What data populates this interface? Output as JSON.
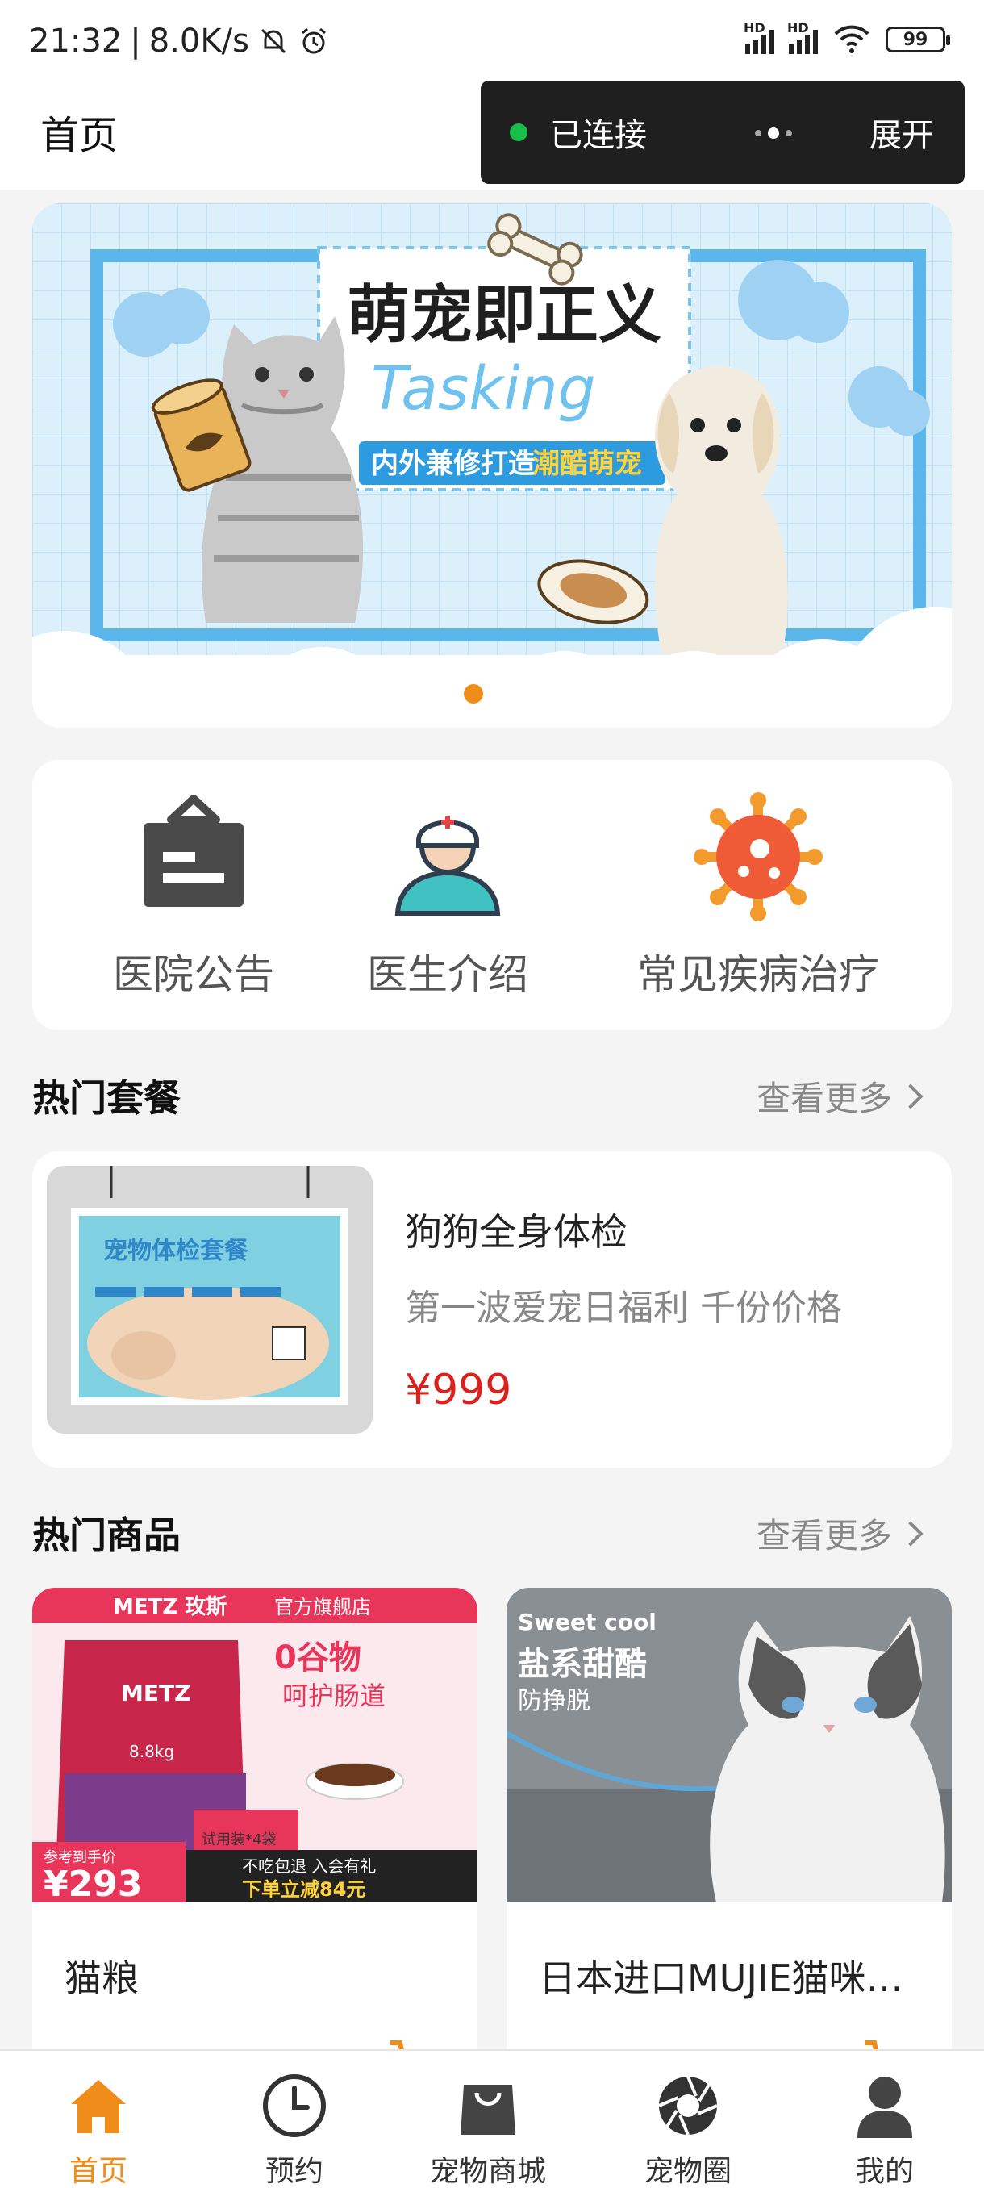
{
  "status_bar": {
    "time": "21:32",
    "speed": "8.0K/s",
    "signal_label": "HD",
    "battery": "99"
  },
  "header": {
    "title": "首页",
    "connection_status": "已连接",
    "expand_label": "展开"
  },
  "banner": {
    "headline": "萌宠即正义",
    "script_text": "Tasking",
    "tagline_prefix": "内外兼修打造",
    "tagline_highlight": "潮酷萌宠",
    "active_slide": 1,
    "slide_count": 1
  },
  "quick_menu": {
    "items": [
      {
        "label": "医院公告",
        "icon": "notice-board-icon"
      },
      {
        "label": "医生介绍",
        "icon": "doctor-icon"
      },
      {
        "label": "常见疾病治疗",
        "icon": "virus-icon"
      }
    ]
  },
  "hot_packages": {
    "title": "热门套餐",
    "more_label": "查看更多",
    "items": [
      {
        "name": "狗狗全身体检",
        "description": "第一波爱宠日福利 千份价格",
        "price": "¥999",
        "image_title": "宠物体检套餐"
      }
    ]
  },
  "hot_products": {
    "title": "热门商品",
    "more_label": "查看更多",
    "items": [
      {
        "name": "猫粮",
        "image_brand": "METZ 玫斯",
        "image_store": "官方旗舰店",
        "image_slogan_1": "0谷物",
        "image_slogan_2": "呵护肠道",
        "image_price_label": "参考到手价",
        "image_price": "¥293",
        "image_promo_1": "不吃包退 入会有礼",
        "image_promo_2": "下单立减84元",
        "image_trial": "试用装*4袋",
        "image_weight": "8.8kg"
      },
      {
        "name": "日本进口MUJIE猫咪牵引绳",
        "image_en": "Sweet cool",
        "image_title": "盐系甜酷",
        "image_sub": "防挣脱"
      }
    ]
  },
  "tab_bar": {
    "items": [
      {
        "label": "首页",
        "icon": "home-icon",
        "active": true
      },
      {
        "label": "预约",
        "icon": "clock-icon",
        "active": false
      },
      {
        "label": "宠物商城",
        "icon": "shopping-bag-icon",
        "active": false
      },
      {
        "label": "宠物圈",
        "icon": "aperture-icon",
        "active": false
      },
      {
        "label": "我的",
        "icon": "user-icon",
        "active": false
      }
    ]
  },
  "colors": {
    "accent": "#f08c1a",
    "price": "#d9221c",
    "connected": "#18c04a"
  }
}
